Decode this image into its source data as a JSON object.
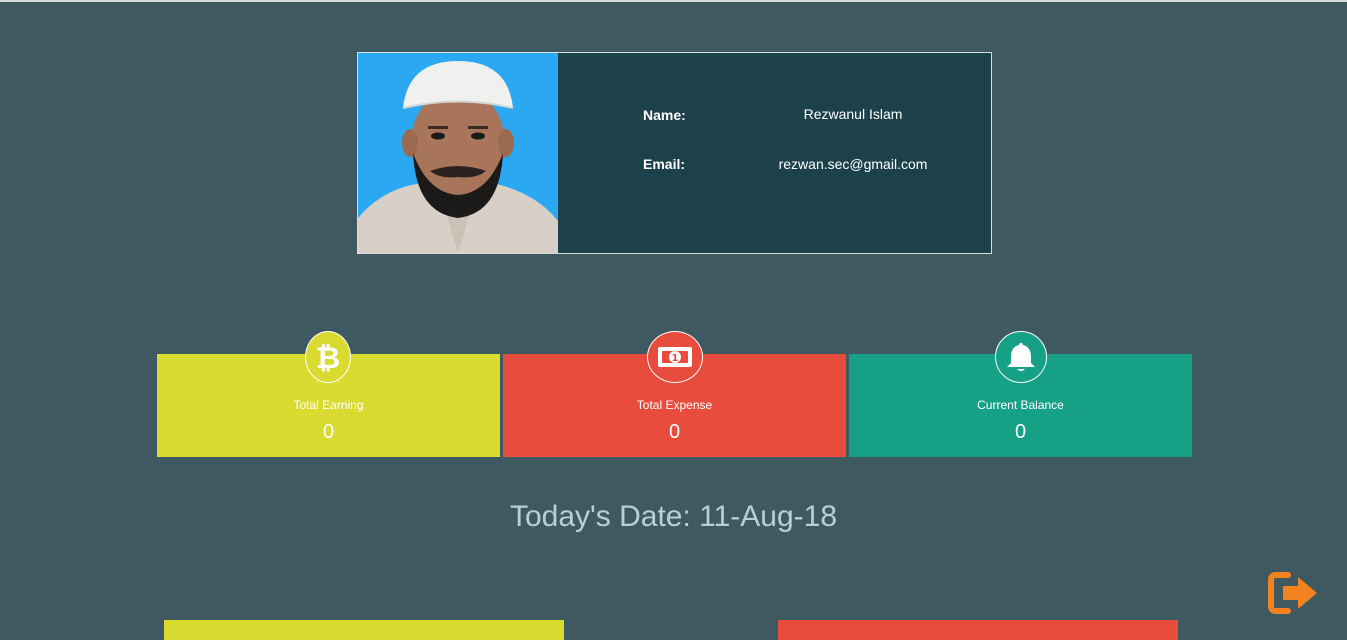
{
  "profile": {
    "name_label": "Name:",
    "name_value": "Rezwanul Islam",
    "email_label": "Email:",
    "email_value": "rezwan.sec@gmail.com"
  },
  "cards": [
    {
      "label": "Total Earning",
      "value": "0",
      "color": "#d9db31",
      "icon": "bitcoin-icon"
    },
    {
      "label": "Total Expense",
      "value": "0",
      "color": "#e74c3c",
      "icon": "money-bill-icon"
    },
    {
      "label": "Current Balance",
      "value": "0",
      "color": "#16a085",
      "icon": "bell-icon"
    }
  ],
  "date_text": "Today's Date: 11-Aug-18",
  "colors": {
    "background": "#3e5a60",
    "profile_panel": "#1d414b",
    "logout_accent": "#f58220"
  },
  "bottom_buttons": [
    {
      "color": "#d9db31"
    },
    {
      "color": "#e74c3c"
    }
  ]
}
